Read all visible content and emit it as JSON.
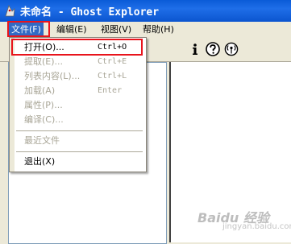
{
  "window": {
    "title": "未命名 - Ghost Explorer"
  },
  "menubar": {
    "file": "文件(F)",
    "edit": "编辑(E)",
    "view": "视图(V)",
    "help": "帮助(H)"
  },
  "file_menu": {
    "items": [
      {
        "label": "打开(O)...",
        "shortcut": "Ctrl+O",
        "enabled": true
      },
      {
        "label": "提取(E)...",
        "shortcut": "Ctrl+E",
        "enabled": false
      },
      {
        "label": "列表内容(L)...",
        "shortcut": "Ctrl+L",
        "enabled": false
      },
      {
        "label": "加载(A)",
        "shortcut": "Enter",
        "enabled": false
      },
      {
        "label": "属性(P)...",
        "shortcut": "",
        "enabled": false
      },
      {
        "label": "编译(C)...",
        "shortcut": "",
        "enabled": false
      },
      {
        "label": "最近文件",
        "shortcut": "",
        "enabled": false
      },
      {
        "label": "退出(X)",
        "shortcut": "",
        "enabled": true
      }
    ]
  },
  "toolbar": {
    "icons": [
      "info-icon",
      "help-icon",
      "wireless-icon"
    ]
  },
  "watermark": {
    "brand": "Baidu 经验",
    "sub": "jingyan.baidu.com"
  },
  "colors": {
    "titlebar": "#0a5bd7",
    "highlight": "#e8141c",
    "menu_selected": "#316ac5"
  }
}
